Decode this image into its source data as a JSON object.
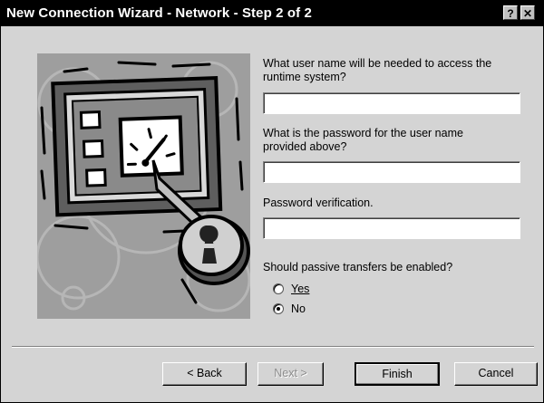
{
  "window": {
    "title": "New Connection Wizard - Network - Step 2 of 2",
    "help_glyph": "?",
    "close_glyph": "✕"
  },
  "questions": {
    "username": {
      "label": "What user name will be needed to access the\nruntime system?",
      "value": ""
    },
    "password": {
      "label": "What is the password for the user name\nprovided above?",
      "value": ""
    },
    "verification": {
      "label": "Password verification.",
      "value": ""
    }
  },
  "passive": {
    "label": "Should passive transfers be enabled?",
    "options": [
      {
        "label": "Yes",
        "selected": false
      },
      {
        "label": "No",
        "selected": true
      }
    ]
  },
  "buttons": {
    "back": "< Back",
    "next": "Next >",
    "finish": "Finish",
    "cancel": "Cancel"
  },
  "icons": {
    "illustration": "computer-monitor-lock-icon"
  }
}
